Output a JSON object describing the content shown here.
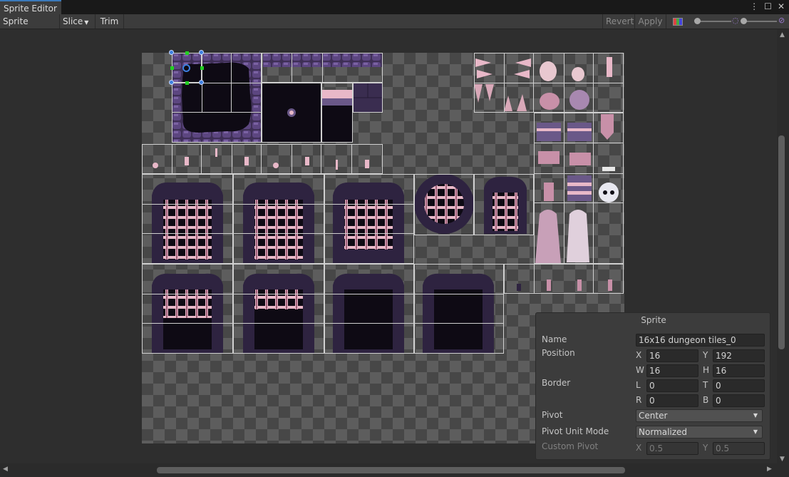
{
  "window": {
    "tab_title": "Sprite Editor"
  },
  "toolbar": {
    "mode_label": "Sprite Editor",
    "slice_label": "Slice",
    "trim_label": "Trim",
    "revert_label": "Revert",
    "apply_label": "Apply"
  },
  "colors": {
    "accent": "#3a79bb",
    "dungeon_dark": "#0e0a14",
    "dungeon_purple": "#4a3a60",
    "dungeon_pink": "#e8b8c8"
  },
  "sprite_panel": {
    "title": "Sprite",
    "name_label": "Name",
    "name_value": "16x16 dungeon tiles_0",
    "position_label": "Position",
    "x_label": "X",
    "x_value": "16",
    "y_label": "Y",
    "y_value": "192",
    "w_label": "W",
    "w_value": "16",
    "h_label": "H",
    "h_value": "16",
    "border_label": "Border",
    "l_label": "L",
    "l_value": "0",
    "t_label": "T",
    "t_value": "0",
    "r_label": "R",
    "r_value": "0",
    "b_label": "B",
    "b_value": "0",
    "pivot_label": "Pivot",
    "pivot_value": "Center",
    "pivot_unit_label": "Pivot Unit Mode",
    "pivot_unit_value": "Normalized",
    "custom_pivot_label": "Custom Pivot",
    "cpx_label": "X",
    "cpx_value": "0.5",
    "cpy_label": "Y",
    "cpy_value": "0.5"
  }
}
